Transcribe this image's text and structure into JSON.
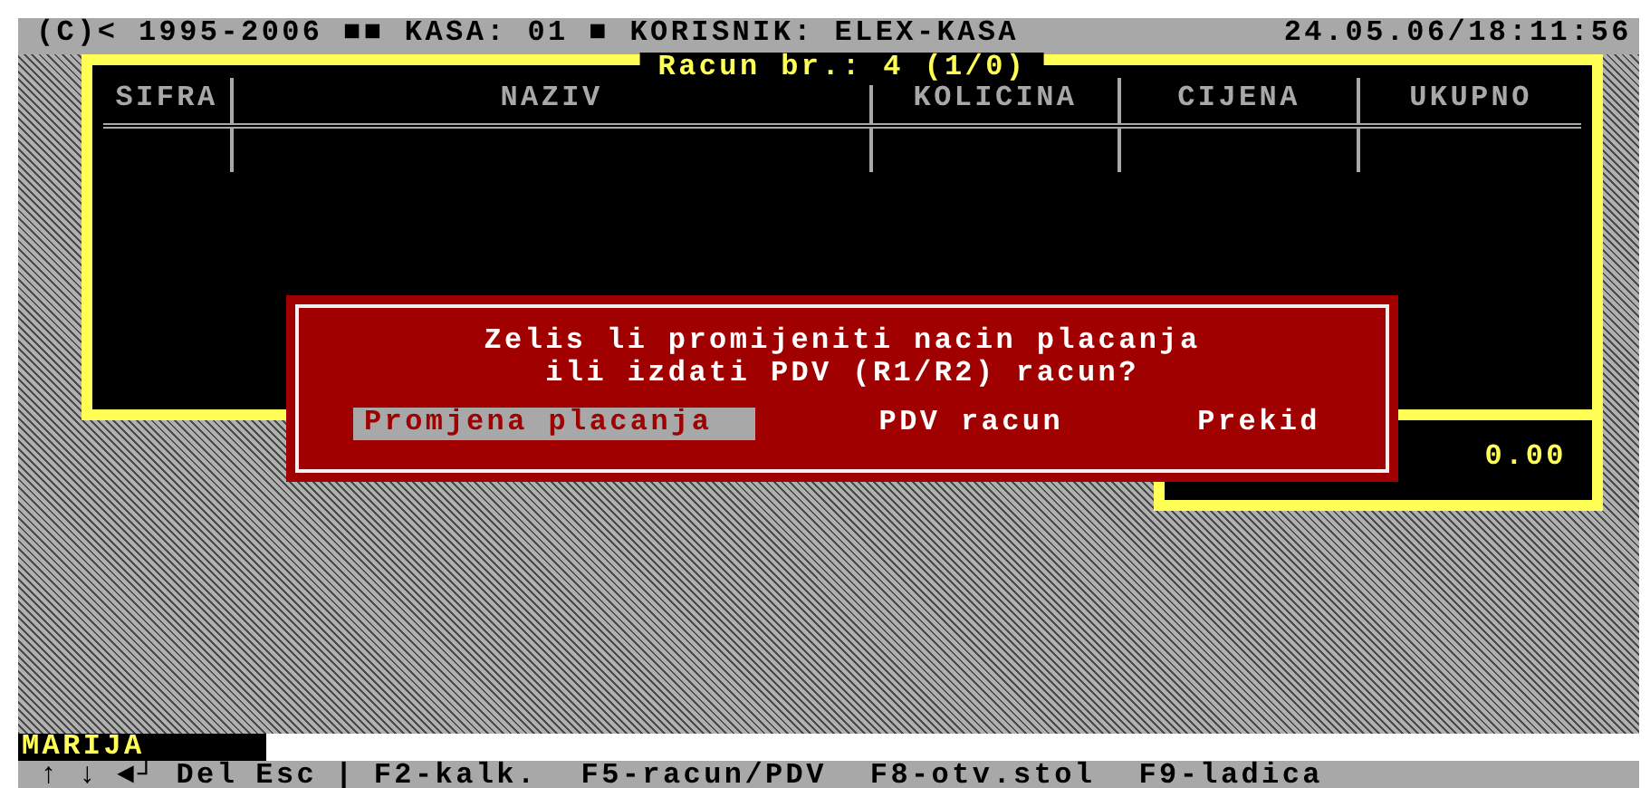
{
  "top_bar": {
    "info": "(C)< 1995-2006 ■■ KASA: 01 ■ KORISNIK: ELEX-KASA",
    "datetime": "24.05.06/18:11:56"
  },
  "receipt": {
    "title": "Racun br.: 4 (1/0)",
    "columns": [
      "SIFRA",
      "NAZIV",
      "KOLICINA",
      "CIJENA",
      "UKUPNO"
    ],
    "total": "0.00"
  },
  "dialog": {
    "message": [
      "Zelis li promijeniti nacin placanja",
      "ili izdati PDV (R1/R2) racun?"
    ],
    "options": [
      {
        "label": "Promjena placanja",
        "selected": true
      },
      {
        "label": "PDV racun",
        "selected": false
      },
      {
        "label": "Prekid",
        "selected": false
      }
    ]
  },
  "user": "MARIJA",
  "key_bar": [
    "↑",
    "↓",
    "◄┘",
    "Del",
    "Esc",
    "|",
    "F2-kalk.",
    "F5-racun/PDV",
    "F8-otv.stol",
    "F9-ladica"
  ]
}
